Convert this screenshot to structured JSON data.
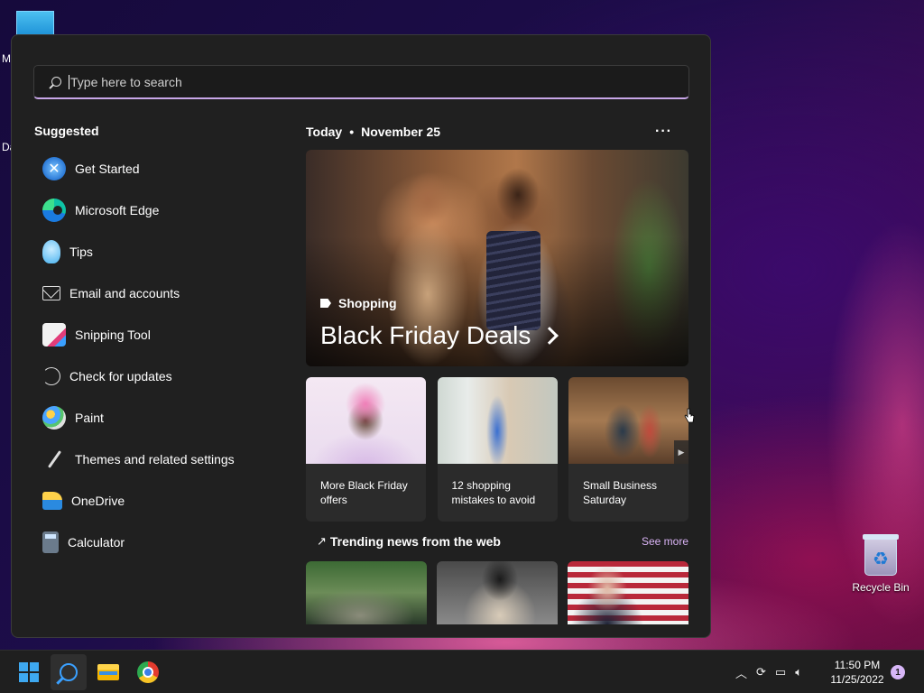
{
  "desktop": {
    "left_fragment_1": "M",
    "left_fragment_2": "Da",
    "recycle_bin_label": "Recycle Bin"
  },
  "search": {
    "placeholder": "Type here to search"
  },
  "suggested": {
    "title": "Suggested",
    "items": [
      {
        "label": "Get Started",
        "icon": "get-started-icon"
      },
      {
        "label": "Microsoft Edge",
        "icon": "edge-icon"
      },
      {
        "label": "Tips",
        "icon": "tips-icon"
      },
      {
        "label": "Email and accounts",
        "icon": "mail-icon"
      },
      {
        "label": "Snipping Tool",
        "icon": "snipping-tool-icon"
      },
      {
        "label": "Check for updates",
        "icon": "refresh-icon"
      },
      {
        "label": "Paint",
        "icon": "paint-icon"
      },
      {
        "label": "Themes and related settings",
        "icon": "brush-icon"
      },
      {
        "label": "OneDrive",
        "icon": "onedrive-icon"
      },
      {
        "label": "Calculator",
        "icon": "calculator-icon"
      }
    ]
  },
  "today": {
    "label": "Today",
    "date": "November 25",
    "more": "···",
    "hero": {
      "category": "Shopping",
      "headline": "Black Friday Deals"
    },
    "cards": [
      {
        "caption": "More Black Friday offers"
      },
      {
        "caption": "12 shopping mistakes to avoid"
      },
      {
        "caption": "Small Business Saturday"
      }
    ],
    "trending": {
      "title": "Trending news from the web",
      "see_more": "See more"
    }
  },
  "taskbar": {
    "time": "11:50 PM",
    "date": "11/25/2022",
    "notification_count": "1"
  },
  "colors": {
    "accent": "#3ea8f0",
    "link": "#d9b3f5",
    "panel_bg": "#202020"
  }
}
